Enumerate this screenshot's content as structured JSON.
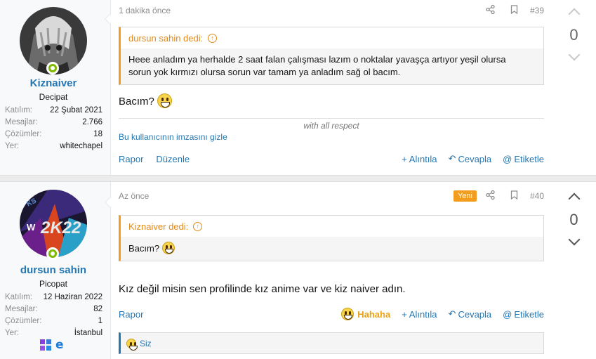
{
  "posts": [
    {
      "user": {
        "name": "Kiznaiver",
        "title": "Decipat",
        "stats": [
          {
            "label": "Katılım:",
            "value": "22 Şubat 2021"
          },
          {
            "label": "Mesajlar:",
            "value": "2.766"
          },
          {
            "label": "Çözümler:",
            "value": "18"
          },
          {
            "label": "Yer:",
            "value": "whitechapel"
          }
        ]
      },
      "time": "1 dakika önce",
      "post_number": "#39",
      "quote": {
        "author": "dursun sahin dedi:",
        "text": "Heee anladım ya herhalde 2 saat falan çalışması lazım o noktalar yavaşça artıyor yeşil olursa sorun yok kırmızı olursa sorun var tamam ya anladım sağ ol bacım."
      },
      "message": "Bacım?",
      "signature": "with all respect",
      "hide_signature": "Bu kullanıcının imzasını gizle",
      "actions": {
        "report": "Rapor",
        "edit": "Düzenle",
        "quote": "Alıntıla",
        "reply": "Cevapla",
        "tag": "Etiketle"
      },
      "vote_count": "0"
    },
    {
      "user": {
        "name": "dursun sahin",
        "title": "Picopat",
        "stats": [
          {
            "label": "Katılım:",
            "value": "12 Haziran 2022"
          },
          {
            "label": "Mesajlar:",
            "value": "82"
          },
          {
            "label": "Çözümler:",
            "value": "1"
          },
          {
            "label": "Yer:",
            "value": "İstanbul"
          }
        ],
        "avatar_badge": "KS"
      },
      "time": "Az önce",
      "badge": "Yeni",
      "post_number": "#40",
      "quote": {
        "author": "Kiznaiver dedi:",
        "text": "Bacım?"
      },
      "message": "Kız değil misin sen profilinde kız anime var ve kiz naiver adın.",
      "actions": {
        "report": "Rapor",
        "reaction": "Hahaha",
        "quote": "Alıntıla",
        "reply": "Cevapla",
        "tag": "Etiketle"
      },
      "reactions_by": "Siz",
      "vote_count": "0"
    }
  ],
  "colors": {
    "link": "#2577b1",
    "quote_accent": "#f29d1f",
    "new_badge": "#f29d1f",
    "online": "#7fb900"
  }
}
